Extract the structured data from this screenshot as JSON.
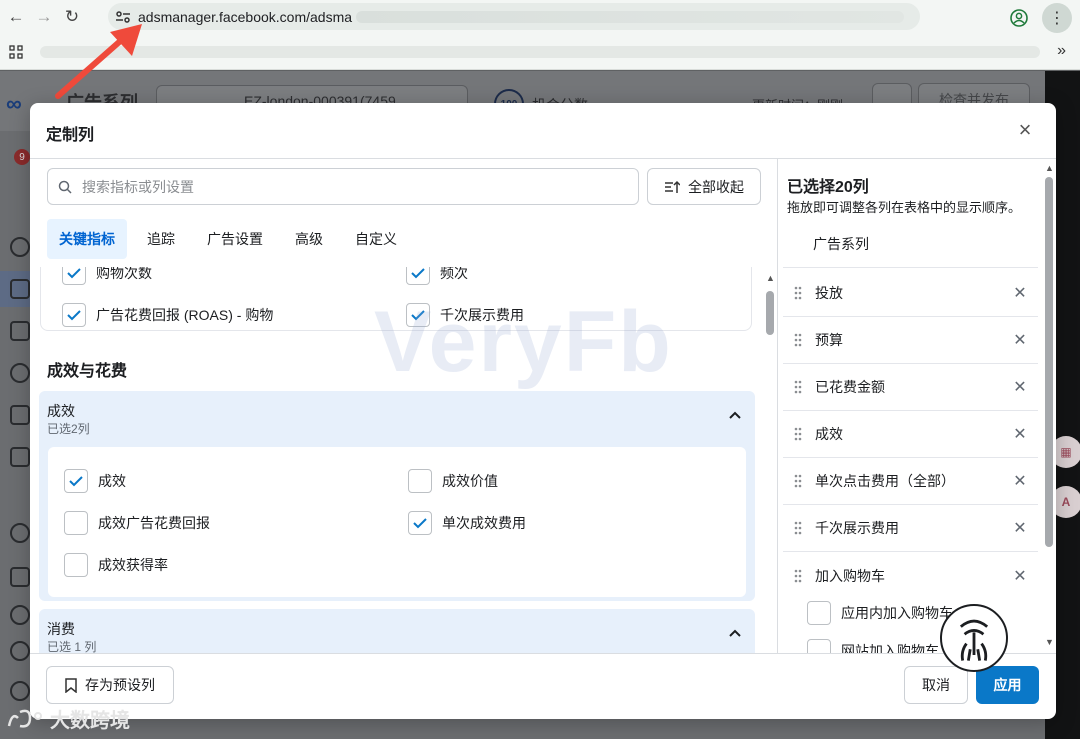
{
  "browser": {
    "url": "adsmanager.facebook.com/adsma"
  },
  "background": {
    "page_title": "广告系列",
    "account_text": "EZ-london-000391(7459",
    "badge_value": "100",
    "badge_label": "机会分数",
    "updated_text": "更新时间：刚刚",
    "review_label": "检查并发布",
    "notification_count": "9"
  },
  "modal": {
    "title": "定制列",
    "search_placeholder": "搜索指标或列设置",
    "collapse_all": "全部收起",
    "tabs": [
      "关键指标",
      "追踪",
      "广告设置",
      "高级",
      "自定义"
    ],
    "previous_items": [
      {
        "label": "购物次数",
        "checked": true
      },
      {
        "label": "频次",
        "checked": true
      },
      {
        "label": "广告花费回报 (ROAS) - 购物",
        "checked": true
      },
      {
        "label": "千次展示费用",
        "checked": true
      }
    ],
    "section_title": "成效与花费",
    "group_results": {
      "name": "成效",
      "sub": "已选2列",
      "items": [
        {
          "label": "成效",
          "checked": true
        },
        {
          "label": "成效价值",
          "checked": false
        },
        {
          "label": "成效广告花费回报",
          "checked": false
        },
        {
          "label": "单次成效费用",
          "checked": true
        },
        {
          "label": "成效获得率",
          "checked": false
        }
      ]
    },
    "group_spend": {
      "name": "消费",
      "sub": "已选 1 列"
    },
    "selected": {
      "title": "已选择20列",
      "desc": "拖放即可调整各列在表格中的显示顺序。",
      "fixed_item": "广告系列",
      "items": [
        "投放",
        "预算",
        "已花费金额",
        "成效",
        "单次点击费用（全部）",
        "千次展示费用",
        "加入购物车"
      ],
      "sub_items": [
        "应用内加入购物车",
        "网站加入购物车"
      ]
    },
    "footer": {
      "save_preset": "存为预设列",
      "cancel": "取消",
      "apply": "应用"
    }
  },
  "watermark": "VeryFb",
  "bottom_brand": "大数跨境",
  "colors": {
    "accent": "#0a78c8",
    "tab_active_bg": "#e7f3ff",
    "group_bg": "#e7f0fb",
    "check": "#0a78c8",
    "arrow": "#ef4a3b"
  }
}
